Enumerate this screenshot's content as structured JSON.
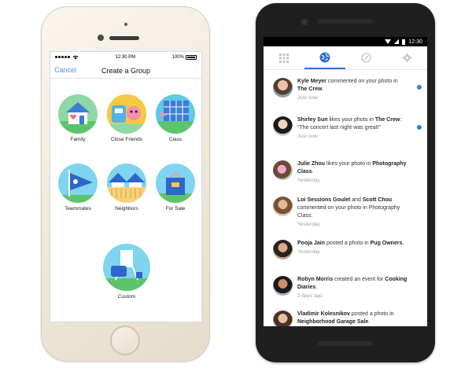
{
  "ios": {
    "status": {
      "carrier": "•••••",
      "time": "12:30 PM",
      "battery": "100%"
    },
    "nav": {
      "cancel": "Cancel",
      "title": "Create a Group"
    },
    "groups": [
      {
        "label": "Family",
        "bg": "#8fd8a6"
      },
      {
        "label": "Close Friends",
        "bg": "#f6c843"
      },
      {
        "label": "Class",
        "bg": "#5fc9e6"
      },
      {
        "label": "Teammates",
        "bg": "#7fd4ef"
      },
      {
        "label": "Neighbors",
        "bg": "#8fd8a6"
      },
      {
        "label": "For Sale",
        "bg": "#7fd4ef"
      },
      {
        "label": "Custom",
        "bg": "#7fd4ef"
      }
    ]
  },
  "android": {
    "status": {
      "time": "12:30"
    },
    "tabs": [
      {
        "icon": "grid-icon",
        "active": false
      },
      {
        "icon": "globe-icon",
        "active": true
      },
      {
        "icon": "compass-icon",
        "active": false
      },
      {
        "icon": "gear-icon",
        "active": false
      }
    ],
    "notifications": [
      {
        "actor": "Kyle Meyer",
        "middle": " commented on your photo in ",
        "target": "The Crew",
        "tail": ".",
        "time": "Just now",
        "unread": true
      },
      {
        "actor": "Shirley Sun",
        "middle": " likes your photo in ",
        "target": "The Crew",
        "tail": ": “The concert last night was great!”",
        "time": "Just now",
        "unread": true
      },
      {
        "actor": "Julie Zhou",
        "middle": " likes your photo in ",
        "target": "Photography Class",
        "tail": ".",
        "time": "Yesterday",
        "unread": false
      },
      {
        "actor": "Loi Sessions Goulet",
        "middle": " and ",
        "target": "Scott Chou",
        "tail": " commented on your photo in Photography Class.",
        "time": "Yesterday",
        "unread": false
      },
      {
        "actor": "Pooja Jain",
        "middle": " posted a photo in ",
        "target": "Pug Owners",
        "tail": ".",
        "time": "Yesterday",
        "unread": false
      },
      {
        "actor": "Robyn Morris",
        "middle": " created an event for ",
        "target": "Cooking Diaries",
        "tail": ".",
        "time": "2 days ago",
        "unread": false
      },
      {
        "actor": "Vladimir Kolesnikov",
        "middle": " posted a photo in ",
        "target": "Neighborhood Garage Sale",
        "tail": ".",
        "time": "",
        "unread": false
      }
    ]
  },
  "colors": {
    "accent": "#2f80ed",
    "ios_link": "#4a90e2"
  }
}
